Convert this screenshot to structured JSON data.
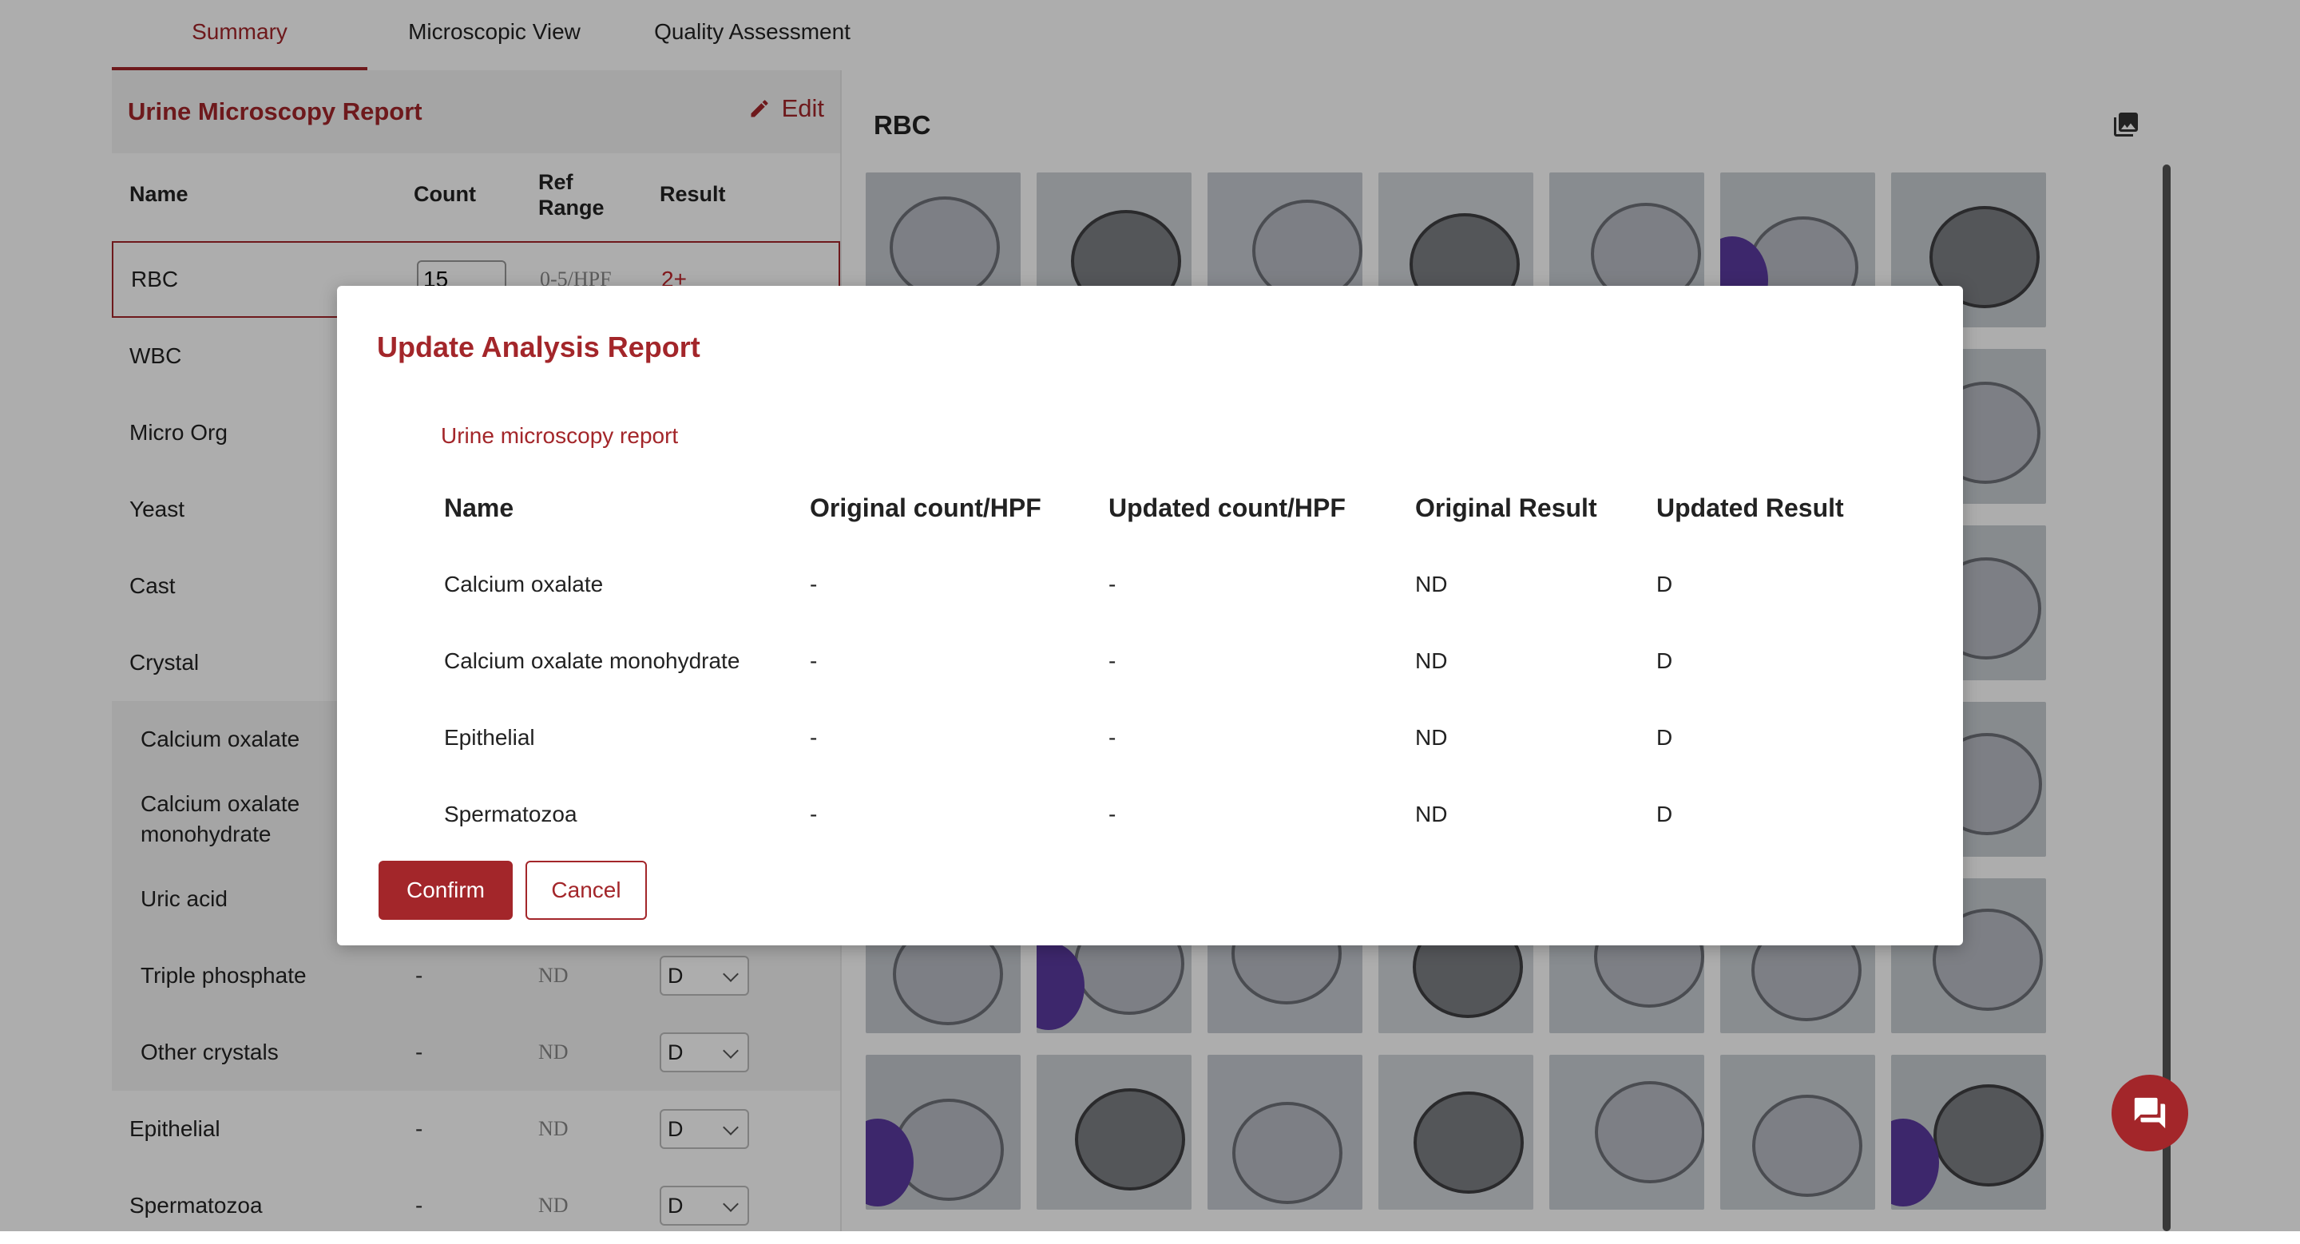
{
  "tabs": [
    {
      "label": "Summary",
      "active": true
    },
    {
      "label": "Microscopic View",
      "active": false
    },
    {
      "label": "Quality Assessment",
      "active": false
    }
  ],
  "report": {
    "title": "Urine Microscopy Report",
    "edit_label": "Edit",
    "columns": {
      "name": "Name",
      "count": "Count",
      "ref_range": "Ref\nRange",
      "result": "Result"
    },
    "rows": [
      {
        "name": "RBC",
        "count": "15",
        "ref": "0-5/HPF",
        "result": "2+"
      },
      {
        "name": "WBC"
      },
      {
        "name": "Micro Org"
      },
      {
        "name": "Yeast"
      },
      {
        "name": "Cast"
      },
      {
        "name": "Crystal"
      },
      {
        "name": "Calcium oxalate"
      },
      {
        "name": "Calcium oxalate\nmonohydrate"
      },
      {
        "name": "Uric acid"
      },
      {
        "name": "Triple phosphate",
        "count": "-",
        "ref": "ND",
        "result": "D"
      },
      {
        "name": "Other crystals",
        "count": "-",
        "ref": "ND",
        "result": "D"
      },
      {
        "name": "Epithelial",
        "count": "-",
        "ref": "ND",
        "result": "D"
      },
      {
        "name": "Spermatozoa",
        "count": "-",
        "ref": "ND",
        "result": "D"
      }
    ]
  },
  "gallery": {
    "title": "RBC",
    "icon": "image-gallery-icon"
  },
  "modal": {
    "title": "Update Analysis Report",
    "subtitle": "Urine microscopy report",
    "columns": [
      "Name",
      "Original count/HPF",
      "Updated count/HPF",
      "Original Result",
      "Updated Result"
    ],
    "rows": [
      [
        "Calcium oxalate",
        "-",
        "-",
        "ND",
        "D"
      ],
      [
        "Calcium oxalate monohydrate",
        "-",
        "-",
        "ND",
        "D"
      ],
      [
        "Epithelial",
        "-",
        "-",
        "ND",
        "D"
      ],
      [
        "Spermatozoa",
        "-",
        "-",
        "ND",
        "D"
      ]
    ],
    "confirm_label": "Confirm",
    "cancel_label": "Cancel"
  },
  "chat": {
    "icon": "chat-icon"
  },
  "colors": {
    "accent": "#a3262a",
    "overlay": "rgba(0,0,0,0.32)"
  }
}
